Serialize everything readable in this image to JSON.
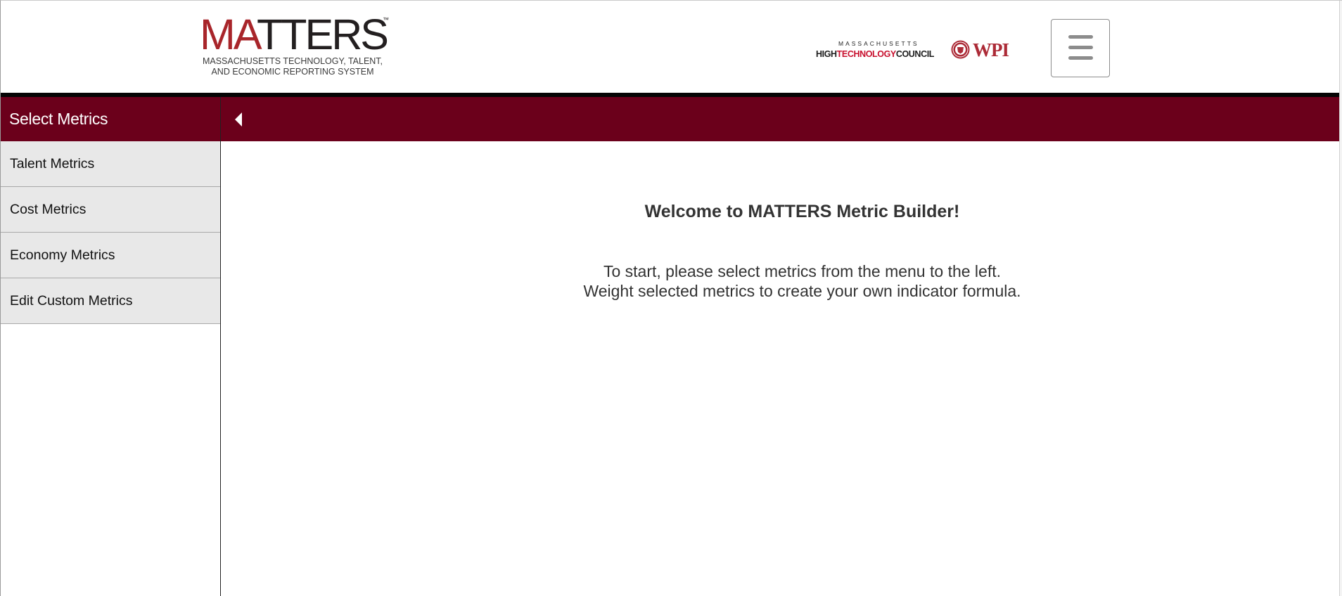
{
  "header": {
    "logo": {
      "word_red": "MA",
      "word_black": "TTERS",
      "trademark": "™",
      "subtitle": "MASSACHUSETTS TECHNOLOGY, TALENT,\nAND ECONOMIC REPORTING SYSTEM",
      "brand_red": "#a8252a"
    },
    "partner_mhtc": {
      "top": "MASSACHUSETTS",
      "high": "HIGH",
      "technology": "TECHNOLOGY",
      "council": "COUNCIL"
    },
    "partner_wpi": {
      "text": "WPI",
      "seal_icon": "wpi-seal-icon"
    },
    "menu_icon": "hamburger-menu-icon"
  },
  "sidebar": {
    "title": "Select Metrics",
    "items": [
      {
        "label": "Talent Metrics"
      },
      {
        "label": "Cost Metrics"
      },
      {
        "label": "Economy Metrics"
      },
      {
        "label": "Edit Custom Metrics"
      }
    ]
  },
  "toolbar": {
    "collapse_icon": "caret-left-icon"
  },
  "main": {
    "title": "Welcome to MATTERS Metric Builder!",
    "line1": "To start, please select metrics from the menu to the left.",
    "line2": "Weight selected metrics to create your own indicator formula."
  },
  "colors": {
    "accent": "#6b001b",
    "sidebar_item_bg": "#e8e8e8",
    "text": "#333333"
  }
}
